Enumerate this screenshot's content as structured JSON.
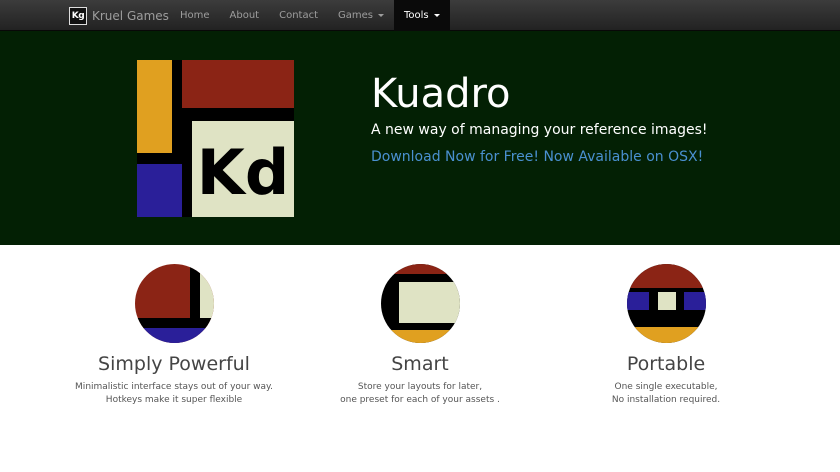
{
  "navbar": {
    "brand_logo": "Kg",
    "brand_name": "Kruel Games",
    "items": [
      {
        "label": "Home"
      },
      {
        "label": "About"
      },
      {
        "label": "Contact"
      },
      {
        "label": "Games"
      },
      {
        "label": "Tools"
      }
    ]
  },
  "hero": {
    "logo_text": "Kd",
    "title": "Kuadro",
    "tagline": "A new way of managing your reference images!",
    "download_link": "Download Now for Free! Now Available on OSX!"
  },
  "features": [
    {
      "title": "Simply Powerful",
      "desc_line1": "Minimalistic interface stays out of your way.",
      "desc_line2": "Hotkeys make it super flexible"
    },
    {
      "title": "Smart",
      "desc_line1": "Store your layouts for later,",
      "desc_line2": "one preset for each of your assets ."
    },
    {
      "title": "Portable",
      "desc_line1": "One single executable,",
      "desc_line2": "No installation required."
    }
  ],
  "colors": {
    "hero_bg": "#032004",
    "link": "#4a90d0",
    "red": "#8b2415",
    "yellow": "#e0a020",
    "blue": "#2a1f99",
    "cream": "#dfe3c4",
    "black": "#000000"
  }
}
